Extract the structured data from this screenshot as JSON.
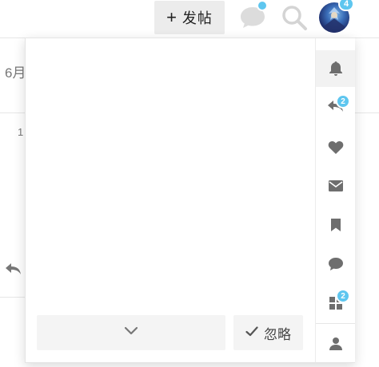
{
  "header": {
    "post_button": {
      "icon": "plus-icon",
      "label": "发帖"
    },
    "chat_icon": "chat-bubble-icon",
    "search_icon": "search-icon",
    "avatar_badge": "4"
  },
  "background": {
    "month_text": "6月",
    "row_number": "1"
  },
  "panel": {
    "tabs": [
      {
        "name": "notifications",
        "icon": "bell-icon",
        "badge": ""
      },
      {
        "name": "replies",
        "icon": "reply-icon",
        "badge": "2"
      },
      {
        "name": "likes",
        "icon": "heart-icon",
        "badge": ""
      },
      {
        "name": "messages",
        "icon": "envelope-icon",
        "badge": ""
      },
      {
        "name": "bookmarks",
        "icon": "bookmark-icon",
        "badge": ""
      },
      {
        "name": "chat",
        "icon": "chat-icon",
        "badge": ""
      },
      {
        "name": "review",
        "icon": "grid-icon",
        "badge": "2"
      },
      {
        "name": "profile",
        "icon": "user-icon",
        "badge": ""
      }
    ],
    "more_button_icon": "chevron-down-icon",
    "ignore_button": {
      "icon": "check-icon",
      "label": "忽略"
    }
  },
  "colors": {
    "badge": "#5ec6ef",
    "icon": "#6e6e6e",
    "button_bg": "#f4f4f4"
  }
}
